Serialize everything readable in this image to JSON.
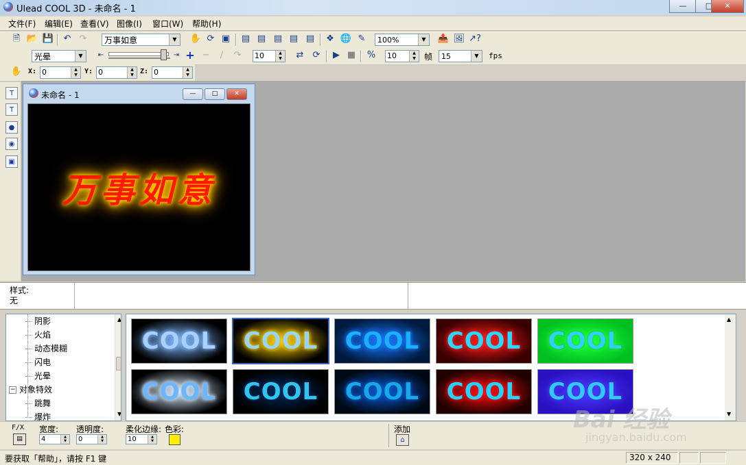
{
  "window": {
    "title": "Ulead COOL 3D - 未命名 - 1"
  },
  "menu": [
    "文件(F)",
    "编辑(E)",
    "查看(V)",
    "图像(I)",
    "窗口(W)",
    "帮助(H)"
  ],
  "toolbar1": {
    "text_combo": "万事如意",
    "zoom_combo": "100%"
  },
  "toolbar2": {
    "effect_combo": "光晕",
    "frame_value": "10",
    "speed_value": "10",
    "frames_label": "帧",
    "fps_value": "15",
    "fps_label": "fps"
  },
  "toolbar3": {
    "x_label": "X:",
    "x_value": "0",
    "y_label": "Y:",
    "y_value": "0",
    "z_label": "Z:",
    "z_value": "0"
  },
  "document": {
    "window_title": "未命名 - 1",
    "canvas_text": "万事如意",
    "text_color": "#ff1a00",
    "glow_color": "#ffd400"
  },
  "style_panel": {
    "label": "样式:",
    "value": "无"
  },
  "tree": {
    "items": [
      {
        "label": "阴影",
        "level": 1
      },
      {
        "label": "火焰",
        "level": 1
      },
      {
        "label": "动态模糊",
        "level": 1
      },
      {
        "label": "闪电",
        "level": 1
      },
      {
        "label": "光晕",
        "level": 1
      },
      {
        "label": "对象特效",
        "level": 0,
        "expander": "−"
      },
      {
        "label": "跳舞",
        "level": 1
      },
      {
        "label": "爆炸",
        "level": 1
      }
    ]
  },
  "thumbnails": [
    {
      "text": "COOL",
      "bg": "#000000",
      "glow": "#7fb8ff",
      "fill": "#a8d0ff"
    },
    {
      "text": "COOL",
      "bg": "#000000",
      "glow": "#ffd200",
      "fill": "#9ad4f0",
      "selected": true
    },
    {
      "text": "COOL",
      "bg": "#001a3d",
      "glow": "#1a78ff",
      "fill": "#1ab0ff"
    },
    {
      "text": "COOL",
      "bg": "#3a0000",
      "glow": "#ff2020",
      "fill": "#2ad8ff"
    },
    {
      "text": "COOL",
      "bg": "#00c020",
      "glow": "#20ff40",
      "fill": "#30d0ff"
    },
    {
      "text": "COOL",
      "bg": "#000000",
      "glow": "#d8ecff",
      "fill": "#6ab6ff"
    },
    {
      "text": "COOL",
      "bg": "#000000",
      "glow": "#002a5a",
      "fill": "#2ec6f0"
    },
    {
      "text": "COOL",
      "bg": "#000814",
      "glow": "#0a5ad0",
      "fill": "#17a8e8"
    },
    {
      "text": "COOL",
      "bg": "#200000",
      "glow": "#ff1010",
      "fill": "#22d2ff"
    },
    {
      "text": "COOL",
      "bg": "#2a10c0",
      "glow": "#4a3cff",
      "fill": "#30c8ff"
    }
  ],
  "params": {
    "fx_label": "F/X",
    "width_label": "宽度:",
    "width_value": "4",
    "opacity_label": "透明度:",
    "opacity_value": "0",
    "soft_label": "柔化边缘:",
    "soft_value": "10",
    "color_label": "色彩:",
    "color_value": "#ffee00",
    "add_label": "添加"
  },
  "status": {
    "help_text": "要获取「帮助」，请按 F1 键",
    "size_text": "320 x 240"
  },
  "watermark": {
    "brand": "Bai  经验",
    "url": "jingyan.baidu.com"
  }
}
